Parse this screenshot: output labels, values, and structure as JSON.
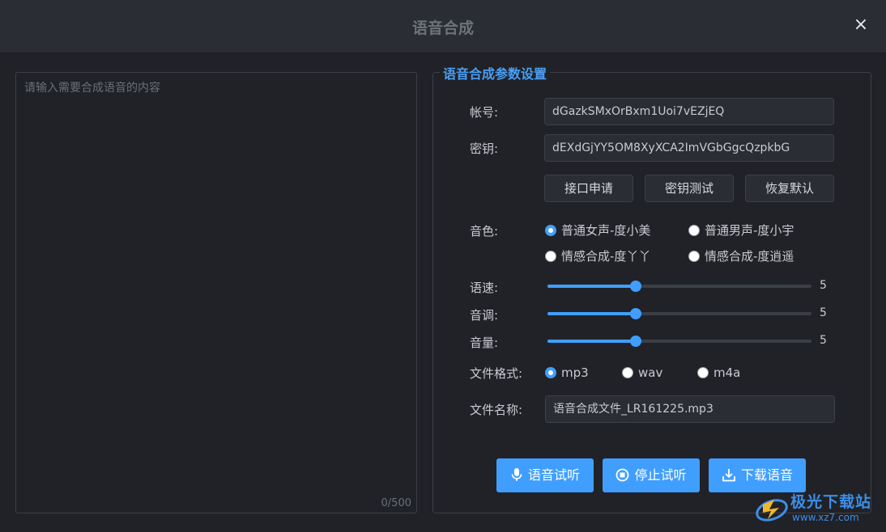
{
  "window": {
    "title": "语音合成",
    "close_glyph": "×"
  },
  "editor": {
    "placeholder": "请输入需要合成语音的内容",
    "value": "",
    "counter": "0/500"
  },
  "settings": {
    "legend": "语音合成参数设置",
    "account": {
      "label": "帐号:",
      "value": "dGazkSMxOrBxm1Uoi7vEZjEQ"
    },
    "secret": {
      "label": "密钥:",
      "value": "dEXdGjYY5OM8XyXCA2ImVGbGgcQzpkbG"
    },
    "buttons": {
      "apply": "接口申请",
      "test": "密钥测试",
      "reset": "恢复默认"
    },
    "voice": {
      "label": "音色:",
      "options": [
        "普通女声-度小美",
        "普通男声-度小宇",
        "情感合成-度丫丫",
        "情感合成-度逍遥"
      ],
      "selected": "普通女声-度小美"
    },
    "speed": {
      "label": "语速:",
      "value": "5",
      "min": 0,
      "max": 15
    },
    "pitch": {
      "label": "音调:",
      "value": "5",
      "min": 0,
      "max": 15
    },
    "volume": {
      "label": "音量:",
      "value": "5",
      "min": 0,
      "max": 15
    },
    "format": {
      "label": "文件格式:",
      "options": [
        "mp3",
        "wav",
        "m4a"
      ],
      "selected": "mp3"
    },
    "filename": {
      "label": "文件名称:",
      "value": "语音合成文件_LR161225.mp3"
    }
  },
  "actions": {
    "preview": "语音试听",
    "stop": "停止试听",
    "download": "下载语音"
  },
  "watermark": {
    "line1": "极光下载站",
    "line2": "www.xz7.com"
  },
  "colors": {
    "accent": "#409eff",
    "background": "#202227",
    "titlebar": "#2a2d33"
  },
  "icons": {
    "preview": "microphone-icon",
    "stop": "stop-circle-icon",
    "download": "download-icon"
  }
}
